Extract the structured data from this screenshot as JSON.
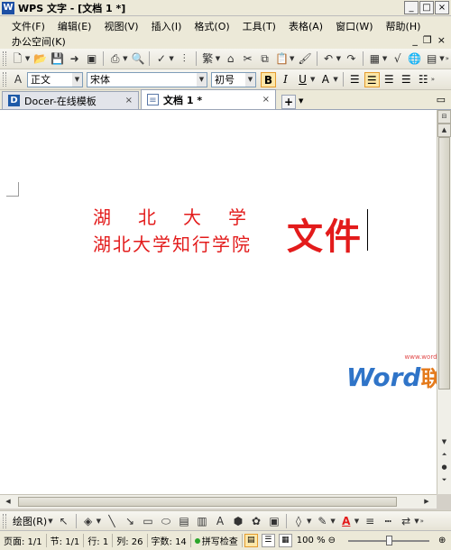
{
  "window": {
    "title": "WPS 文字 - [文档 1 *]",
    "min": "_",
    "max": "□",
    "close": "×"
  },
  "menu": {
    "items": [
      "文件(F)",
      "编辑(E)",
      "视图(V)",
      "插入(I)",
      "格式(O)",
      "工具(T)",
      "表格(A)",
      "窗口(W)",
      "帮助(H)"
    ],
    "office_space": "办公空间(K)",
    "mdi_min": "_",
    "mdi_restore": "❐",
    "mdi_close": "×"
  },
  "format_toolbar": {
    "style": "正文",
    "font": "宋体",
    "size": "初号",
    "bold": "B",
    "italic": "I",
    "underline": "U",
    "fontcolor": "A"
  },
  "tabs": [
    {
      "label": "Docer-在线模板",
      "close": "×"
    },
    {
      "label": "文档 1 *",
      "close": "×"
    }
  ],
  "document": {
    "line1": "湖北大学",
    "line2": "湖北大学知行学院",
    "big": "文件"
  },
  "watermark": {
    "url": "www.wordlm.com",
    "word": "Word",
    "cn": "联盟"
  },
  "drawbar": {
    "label": "绘图(R)"
  },
  "status": {
    "page": "页面: 1/1",
    "section": "节: 1/1",
    "row": "行: 1",
    "col": "列: 26",
    "words": "字数: 14",
    "spell": "拼写检查",
    "zoom": "100 %",
    "zoom_level": 0.5
  },
  "colors": {
    "accent_red": "#e31b1b",
    "watermark_blue": "#2f74c8",
    "watermark_orange": "#e47a1b"
  }
}
